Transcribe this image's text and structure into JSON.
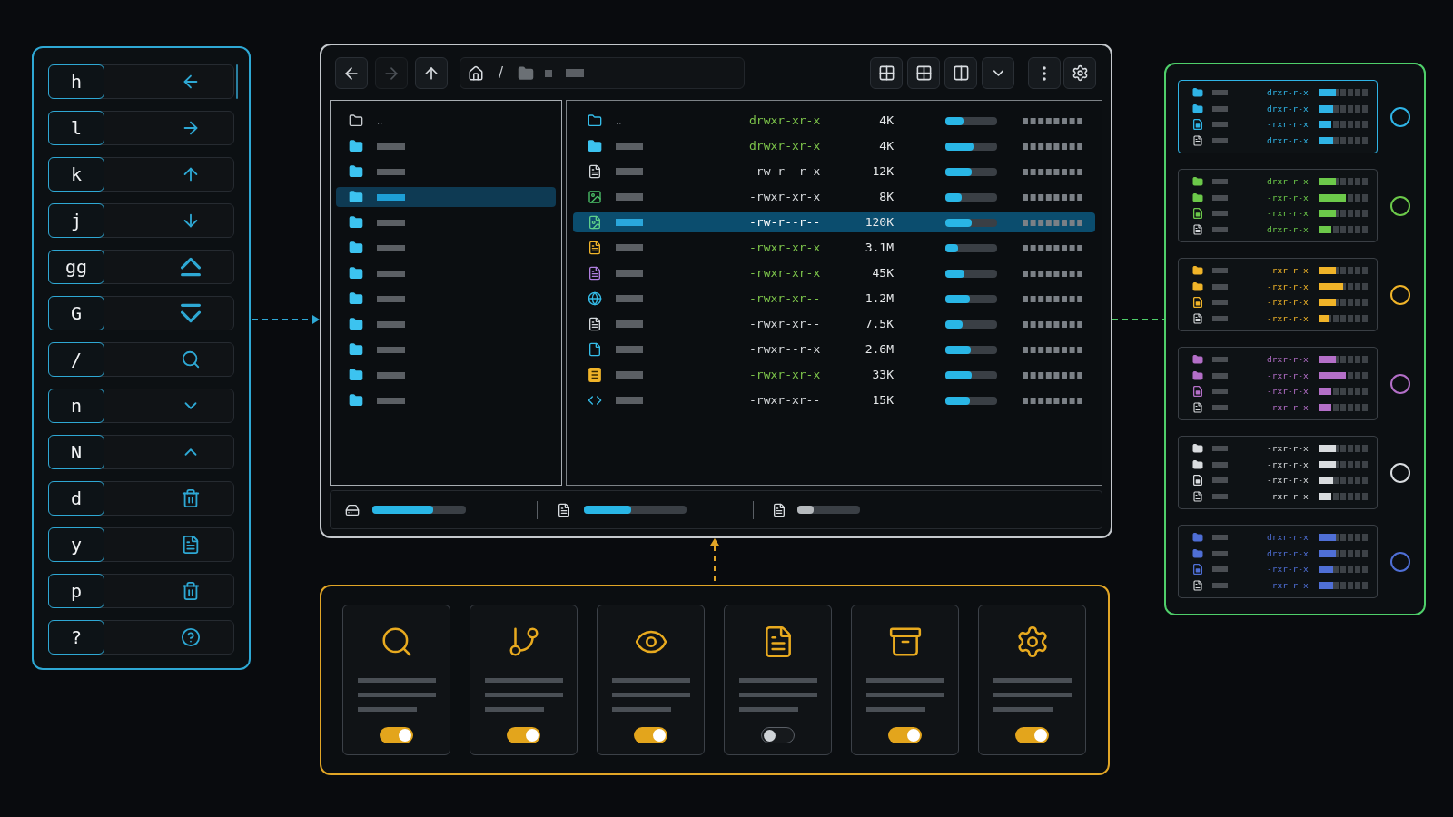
{
  "keybindings": [
    {
      "key": "h"
    },
    {
      "key": "l"
    },
    {
      "key": "k"
    },
    {
      "key": "j"
    },
    {
      "key": "gg"
    },
    {
      "key": "G"
    },
    {
      "key": "/"
    },
    {
      "key": "n"
    },
    {
      "key": "N"
    },
    {
      "key": "d"
    },
    {
      "key": "y"
    },
    {
      "key": "p"
    },
    {
      "key": "?"
    }
  ],
  "file_manager": {
    "nav_buttons": [
      {
        "disabled": false
      },
      {
        "disabled": true
      },
      {
        "disabled": false
      }
    ],
    "breadcrumb": {
      "separator": "/"
    },
    "tree": [
      {
        "kind": "parent",
        "label": "..",
        "selected": false
      },
      {
        "kind": "folder",
        "selected": false
      },
      {
        "kind": "folder",
        "selected": false
      },
      {
        "kind": "folder",
        "selected": true
      },
      {
        "kind": "folder",
        "selected": false
      },
      {
        "kind": "folder",
        "selected": false
      },
      {
        "kind": "folder",
        "selected": false
      },
      {
        "kind": "folder",
        "selected": false
      },
      {
        "kind": "folder",
        "selected": false
      },
      {
        "kind": "folder",
        "selected": false
      },
      {
        "kind": "folder",
        "selected": false
      },
      {
        "kind": "folder",
        "selected": false
      }
    ],
    "files": [
      {
        "kind": "parent",
        "name": "..",
        "permissions": "drwxr-xr-x",
        "color": "#7cc34a",
        "size": "4K",
        "level": 0.35,
        "selected": false
      },
      {
        "kind": "folder",
        "permissions": "drwxr-xr-x",
        "color": "#7cc34a",
        "size": "4K",
        "level": 0.55,
        "selected": false
      },
      {
        "kind": "text",
        "permissions": "-rw-r--r-x",
        "color": "#d4d7da",
        "size": "12K",
        "level": 0.5,
        "selected": false
      },
      {
        "kind": "image",
        "permissions": "-rwxr-xr-x",
        "color": "#d4d7da",
        "size": "8K",
        "level": 0.32,
        "selected": false
      },
      {
        "kind": "chart",
        "permissions": "-rw-r--r--",
        "color": "#ffffff",
        "size": "120K",
        "level": 0.5,
        "selected": true
      },
      {
        "kind": "document",
        "permissions": "-rwxr-xr-x",
        "color": "#7cc34a",
        "size": "3.1M",
        "level": 0.25,
        "selected": false
      },
      {
        "kind": "note",
        "permissions": "-rwxr-xr-x",
        "color": "#7cc34a",
        "size": "45K",
        "level": 0.37,
        "selected": false
      },
      {
        "kind": "web",
        "permissions": "-rwxr-xr--",
        "color": "#7cc34a",
        "size": "1.2M",
        "level": 0.47,
        "selected": false
      },
      {
        "kind": "text",
        "permissions": "-rwxr-xr--",
        "color": "#d4d7da",
        "size": "7.5K",
        "level": 0.34,
        "selected": false
      },
      {
        "kind": "data",
        "permissions": "-rwxr--r-x",
        "color": "#d4d7da",
        "size": "2.6M",
        "level": 0.49,
        "selected": false
      },
      {
        "kind": "archive",
        "permissions": "-rwxr-xr-x",
        "color": "#7cc34a",
        "size": "33K",
        "level": 0.5,
        "selected": false
      },
      {
        "kind": "code",
        "permissions": "-rwxr-xr--",
        "color": "#d4d7da",
        "size": "15K",
        "level": 0.47,
        "selected": false
      }
    ],
    "status_bar": [
      {
        "level": 0.65,
        "color": "#29b6e6"
      },
      {
        "level": 0.46,
        "color": "#29b6e6"
      },
      {
        "level": 0.26,
        "color": "#b5b9bd"
      }
    ]
  },
  "previews": [
    {
      "color": "#2fb4e6",
      "selected": true,
      "rows": [
        {
          "kind": "folder",
          "permissions": "drxr-r-x",
          "level": 0.35
        },
        {
          "kind": "folder",
          "permissions": "drxr-r-x",
          "level": 0.3
        },
        {
          "kind": "media",
          "permissions": "-rxr-r-x",
          "level": 0.25
        },
        {
          "kind": "text",
          "permissions": "drxr-r-x",
          "level": 0.3
        }
      ]
    },
    {
      "color": "#6cc94a",
      "selected": false,
      "rows": [
        {
          "kind": "folder",
          "permissions": "drxr-r-x",
          "level": 0.35
        },
        {
          "kind": "folder",
          "permissions": "-rxr-r-x",
          "level": 0.55
        },
        {
          "kind": "media",
          "permissions": "-rxr-r-x",
          "level": 0.35
        },
        {
          "kind": "text",
          "permissions": "drxr-r-x",
          "level": 0.25
        }
      ]
    },
    {
      "color": "#f0b429",
      "selected": false,
      "rows": [
        {
          "kind": "folder",
          "permissions": "-rxr-r-x",
          "level": 0.35
        },
        {
          "kind": "folder",
          "permissions": "-rxr-r-x",
          "level": 0.5
        },
        {
          "kind": "media",
          "permissions": "-rxr-r-x",
          "level": 0.35
        },
        {
          "kind": "text",
          "permissions": "-rxr-r-x",
          "level": 0.22
        }
      ]
    },
    {
      "color": "#b46fc8",
      "selected": false,
      "rows": [
        {
          "kind": "folder",
          "permissions": "drxr-r-x",
          "level": 0.35
        },
        {
          "kind": "folder",
          "permissions": "-rxr-r-x",
          "level": 0.55
        },
        {
          "kind": "media",
          "permissions": "-rxr-r-x",
          "level": 0.25
        },
        {
          "kind": "text",
          "permissions": "-rxr-r-x",
          "level": 0.25
        }
      ]
    },
    {
      "color": "#d9dcdf",
      "selected": false,
      "rows": [
        {
          "kind": "folder",
          "permissions": "-rxr-r-x",
          "level": 0.35
        },
        {
          "kind": "folder",
          "permissions": "-rxr-r-x",
          "level": 0.35
        },
        {
          "kind": "media",
          "permissions": "-rxr-r-x",
          "level": 0.3
        },
        {
          "kind": "text",
          "permissions": "-rxr-r-x",
          "level": 0.25
        }
      ]
    },
    {
      "color": "#4f6fd6",
      "selected": false,
      "rows": [
        {
          "kind": "folder",
          "permissions": "drxr-r-x",
          "level": 0.35
        },
        {
          "kind": "folder",
          "permissions": "drxr-r-x",
          "level": 0.35
        },
        {
          "kind": "media",
          "permissions": "-rxr-r-x",
          "level": 0.3
        },
        {
          "kind": "text",
          "permissions": "-rxr-r-x",
          "level": 0.3
        }
      ]
    }
  ],
  "features": [
    {
      "on": true
    },
    {
      "on": true
    },
    {
      "on": true
    },
    {
      "on": false
    },
    {
      "on": true
    },
    {
      "on": true
    }
  ]
}
